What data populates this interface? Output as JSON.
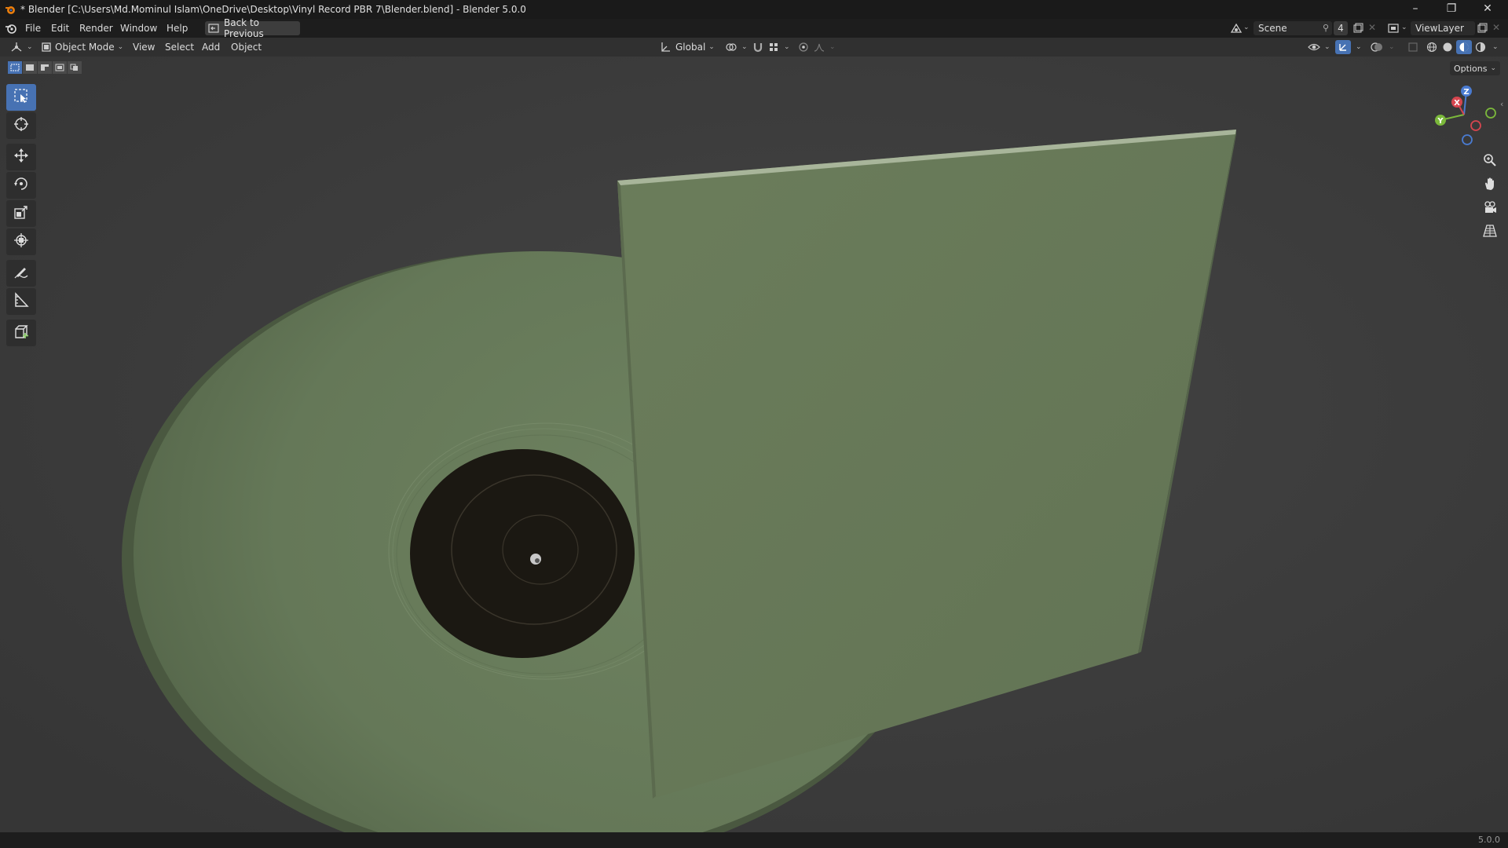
{
  "window": {
    "title": "* Blender [C:\\Users\\Md.Mominul Islam\\OneDrive\\Desktop\\Vinyl Record PBR 7\\Blender.blend] - Blender 5.0.0",
    "minimize": "–",
    "maximize": "❐",
    "close": "✕"
  },
  "topbar": {
    "menus": [
      "File",
      "Edit",
      "Render",
      "Window",
      "Help"
    ],
    "back_label": "Back to Previous",
    "scene_name": "Scene",
    "scene_users": "4",
    "view_layer": "ViewLayer"
  },
  "viewport_header": {
    "mode": "Object Mode",
    "menus": [
      "View",
      "Select",
      "Add",
      "Object"
    ],
    "orientation": "Global"
  },
  "viewport": {
    "options_label": "Options",
    "gizmo": {
      "z": "Z",
      "y": "Y",
      "x": "X"
    }
  },
  "toolbar": {
    "tools": [
      "select-box",
      "cursor",
      "move",
      "rotate",
      "scale",
      "transform",
      "annotate",
      "measure",
      "add-cube"
    ],
    "active_tool": "select-box"
  },
  "statusbar": {
    "version": "5.0.0"
  },
  "colors": {
    "accent": "#4772b3",
    "vinyl_green": "#6a7d5a",
    "label_dark": "#1a1712",
    "background": "#3c3c3c"
  }
}
